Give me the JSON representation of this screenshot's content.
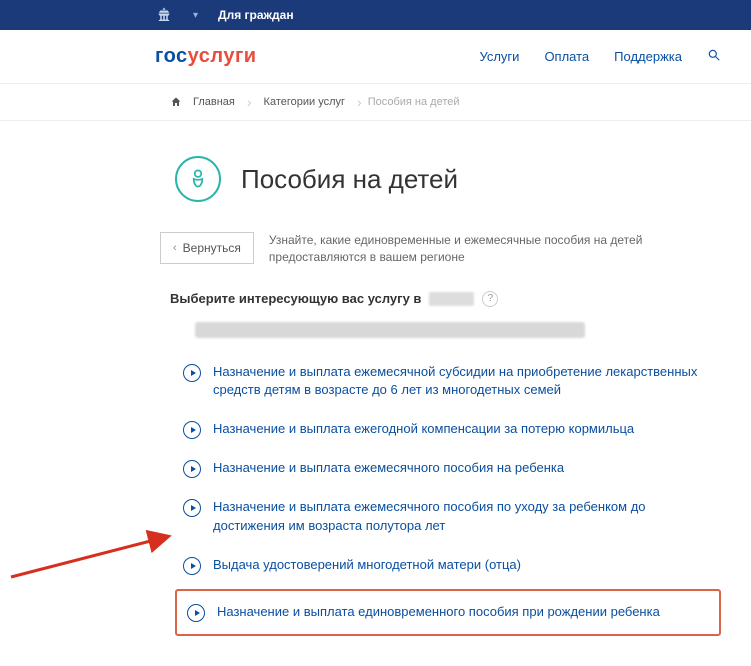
{
  "topbar": {
    "audience": "Для граждан"
  },
  "header": {
    "logo_gos": "гос",
    "logo_usl": "услуги",
    "nav": {
      "services": "Услуги",
      "payment": "Оплата",
      "support": "Поддержка"
    }
  },
  "breadcrumbs": {
    "home": "Главная",
    "category": "Категории услуг",
    "current": "Пособия на детей"
  },
  "page_title": "Пособия на детей",
  "back_label": "Вернуться",
  "intro": "Узнайте, какие единовременные и ежемесячные пособия на детей предоставляются в вашем регионе",
  "region_label": "Выберите интересующую вас услугу в",
  "help_symbol": "?",
  "services": [
    "Назначение и выплата ежемесячной субсидии на приобретение лекарственных средств детям в возрасте до 6 лет из многодетных семей",
    "Назначение и выплата ежегодной компенсации за потерю кормильца",
    "Назначение и выплата ежемесячного пособия на ребенка",
    "Назначение и выплата ежемесячного пособия по уходу за ребенком до достижения им возраста полутора лет",
    "Выдача удостоверений многодетной матери (отца)",
    "Назначение и выплата единовременного пособия при рождении ребенка"
  ]
}
